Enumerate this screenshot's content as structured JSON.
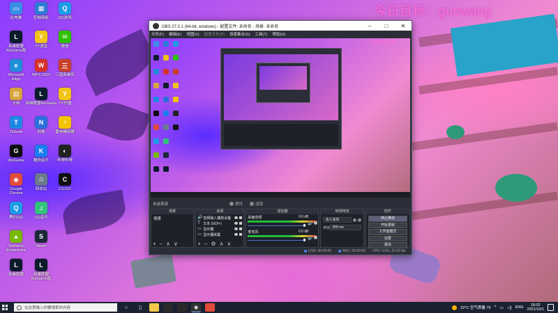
{
  "watermark": "今日目标：guowang",
  "desktop_icons": [
    {
      "label": "此电脑",
      "color": "#3a8ee6",
      "glyph": "▭"
    },
    {
      "label": "英雄联盟\nWeGame版",
      "color": "#0b1b2b",
      "glyph": "L"
    },
    {
      "label": "Microsoft\nEdge",
      "color": "#1f8fd8",
      "glyph": "e"
    },
    {
      "label": "文档",
      "color": "#d7a53a",
      "glyph": "▤"
    },
    {
      "label": "ToDesk",
      "color": "#1e88e5",
      "glyph": "T"
    },
    {
      "label": "WeGame",
      "color": "#0d0d0d",
      "glyph": "G"
    },
    {
      "label": "Google\nChrome",
      "color": "#e04a3a",
      "glyph": "◉"
    },
    {
      "label": "腾讯QQ",
      "color": "#1e9be8",
      "glyph": "Q"
    },
    {
      "label": "GeForce\nExperience",
      "color": "#76b900",
      "glyph": "▲"
    },
    {
      "label": "英雄联盟",
      "color": "#0b1b2b",
      "glyph": "L"
    },
    {
      "label": "控制面板",
      "color": "#2f7bd8",
      "glyph": "▦"
    },
    {
      "label": "YY语音",
      "color": "#f0c419",
      "glyph": "Y"
    },
    {
      "label": "WPS 2019",
      "color": "#d8302a",
      "glyph": "W"
    },
    {
      "label": "英雄联盟WeGame",
      "color": "#0b1b2b",
      "glyph": "L"
    },
    {
      "label": "网易",
      "color": "#2a6fdb",
      "glyph": "N"
    },
    {
      "label": "酷狗音乐",
      "color": "#1a7ef0",
      "glyph": "K"
    },
    {
      "label": "回收站",
      "color": "#6a7a8a",
      "glyph": "♲"
    },
    {
      "label": "QQ音乐",
      "color": "#31c27c",
      "glyph": "♫"
    },
    {
      "label": "Steam",
      "color": "#1b2838",
      "glyph": "S"
    },
    {
      "label": "英雄联盟\nWeGame版",
      "color": "#0b1b2b",
      "glyph": "L"
    },
    {
      "label": "QQ游戏",
      "color": "#1e9be8",
      "glyph": "Q"
    },
    {
      "label": "微信",
      "color": "#2dc100",
      "glyph": "✉"
    },
    {
      "label": "三国英雄传",
      "color": "#c8402a",
      "glyph": "三"
    },
    {
      "label": "YY开播",
      "color": "#f0c419",
      "glyph": "Y"
    },
    {
      "label": "雷电模拟器",
      "color": "#f5c400",
      "glyph": "⚡"
    },
    {
      "label": "哔哩哔哩",
      "color": "#222",
      "glyph": "◐"
    },
    {
      "label": "CS:GO",
      "color": "#111",
      "glyph": "C"
    }
  ],
  "obs": {
    "title": "OBS 27.0.1 (64-bit, windows) - 配置文件: 未命名 - 场景: 未命名",
    "menu": [
      "文件(F)",
      "编辑(E)",
      "视图(V)",
      "配置文件(P)",
      "场景集合(S)",
      "工具(T)",
      "帮助(H)"
    ],
    "scene_label": "未选择源",
    "btn_properties": "属性",
    "btn_filters": "滤镜",
    "docks": {
      "scenes": {
        "title": "场景",
        "items": [
          "场景"
        ]
      },
      "sources": {
        "title": "来源",
        "items": [
          {
            "icon": "🔊",
            "name": "音频输入捕获设备"
          },
          {
            "icon": "T",
            "name": "文本 (GDI+)"
          },
          {
            "icon": "▭",
            "name": "显示器"
          },
          {
            "icon": "▭",
            "name": "显示器采集"
          }
        ]
      },
      "mixer": {
        "title": "混音器",
        "channels": [
          {
            "name": "桌面音频",
            "db": "0.0 dB"
          },
          {
            "name": "麦克风",
            "db": "0.0 dB"
          }
        ]
      },
      "transitions": {
        "title": "转场特效",
        "type": "淡入淡出",
        "duration_label": "时长",
        "duration": "300 ms"
      },
      "controls": {
        "title": "控件",
        "buttons": [
          "停止推流",
          "开始录制",
          "工作室模式",
          "设置",
          "退出"
        ]
      }
    },
    "status": {
      "live": "LIVE: 00:00:00",
      "rec": "REC: 00:00:00",
      "cpu": "CPU: 0.0%, 60.00 fps"
    }
  },
  "taskbar": {
    "search_placeholder": "在这里输入你要搜索的内容",
    "weather": "32°C 空气质量 79",
    "lang": "ENG",
    "time": "18:02",
    "date": "2021/10/1"
  }
}
